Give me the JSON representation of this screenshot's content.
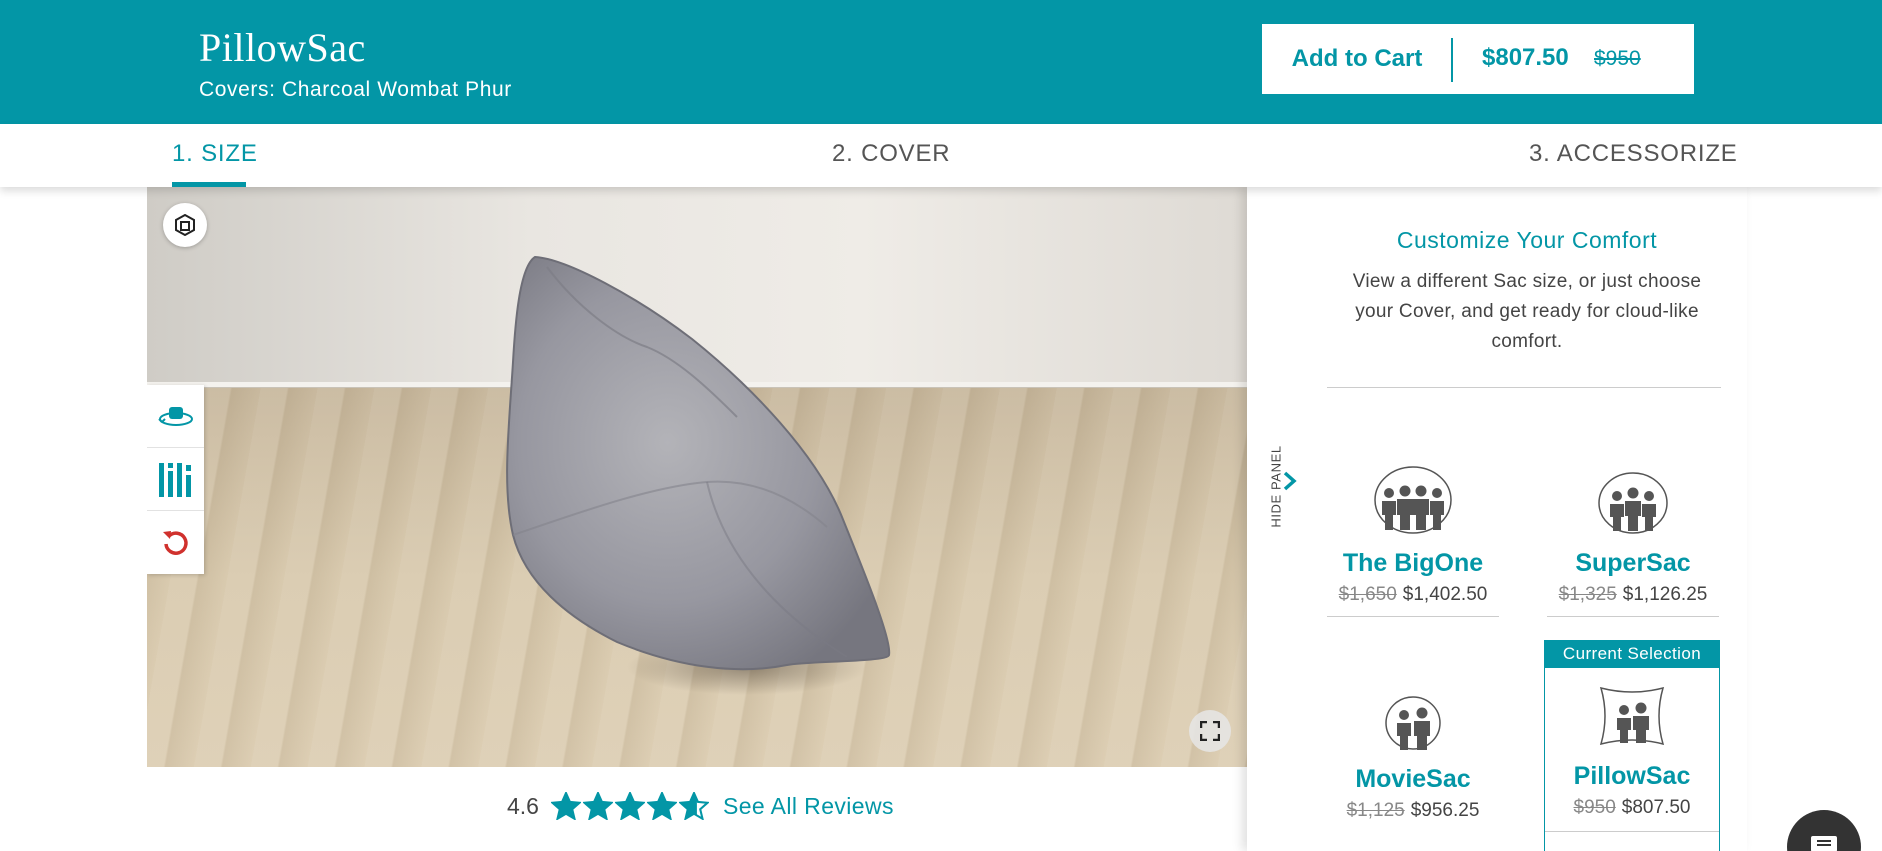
{
  "header": {
    "brand": "PillowSac",
    "cover_line": "Covers: Charcoal Wombat Phur",
    "add_to_cart": "Add to Cart",
    "price_now": "$807.50",
    "price_old": "$950"
  },
  "steps": [
    {
      "label": "1. SIZE",
      "active": true
    },
    {
      "label": "2. COVER",
      "active": false
    },
    {
      "label": "3. ACCESSORIZE",
      "active": false
    }
  ],
  "viewer": {
    "tools": [
      "ar-icon",
      "rotate-3d-icon",
      "measure-icon",
      "reset-icon",
      "fullscreen-icon"
    ]
  },
  "rating": {
    "value": "4.6",
    "stars": 4.6,
    "link": "See All Reviews"
  },
  "panel": {
    "hide_label": "HIDE PANEL",
    "title": "Customize Your Comfort",
    "description": "View a different Sac size, or just choose your Cover, and get ready for cloud-like comfort.",
    "current_selection": "Current Selection",
    "sizes": [
      {
        "name": "The BigOne",
        "old": "$1,650",
        "price": "$1,402.50"
      },
      {
        "name": "SuperSac",
        "old": "$1,325",
        "price": "$1,126.25"
      },
      {
        "name": "MovieSac",
        "old": "$1,125",
        "price": "$956.25"
      },
      {
        "name": "PillowSac",
        "old": "$950",
        "price": "$807.50",
        "selected": true
      }
    ]
  },
  "colors": {
    "accent": "#0396a6",
    "reset": "#d0312d"
  }
}
